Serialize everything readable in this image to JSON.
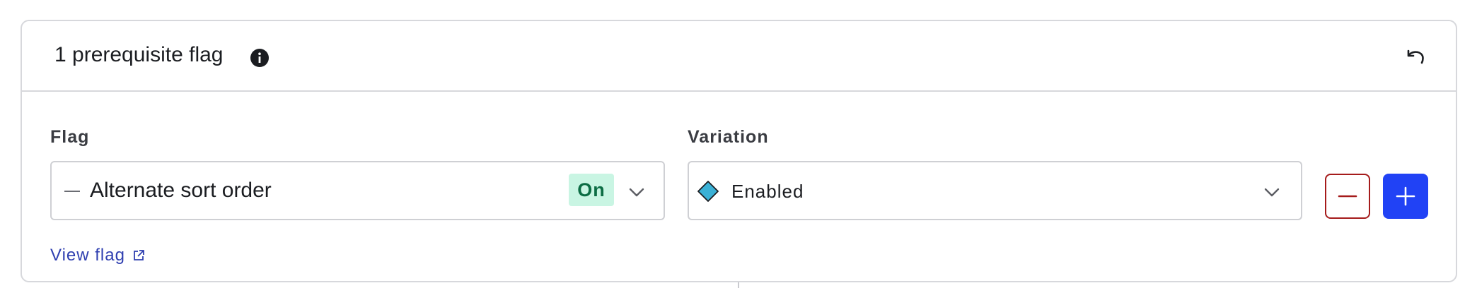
{
  "section": {
    "title": "1 prerequisite flag",
    "info_icon": "info-icon",
    "undo_icon": "undo-icon"
  },
  "fields": {
    "flag_label": "Flag",
    "variation_label": "Variation"
  },
  "flag_select": {
    "value": "Alternate sort order",
    "status_badge": "On",
    "status_color": "#0c6d44",
    "status_bg": "#c9f5e3"
  },
  "variation_select": {
    "value": "Enabled",
    "swatch_color": "#3bb1d6"
  },
  "links": {
    "view_flag": "View flag"
  },
  "actions": {
    "remove_icon": "minus-icon",
    "add_icon": "plus-icon",
    "remove_color": "#a51b1b",
    "add_color": "#2142f5"
  }
}
